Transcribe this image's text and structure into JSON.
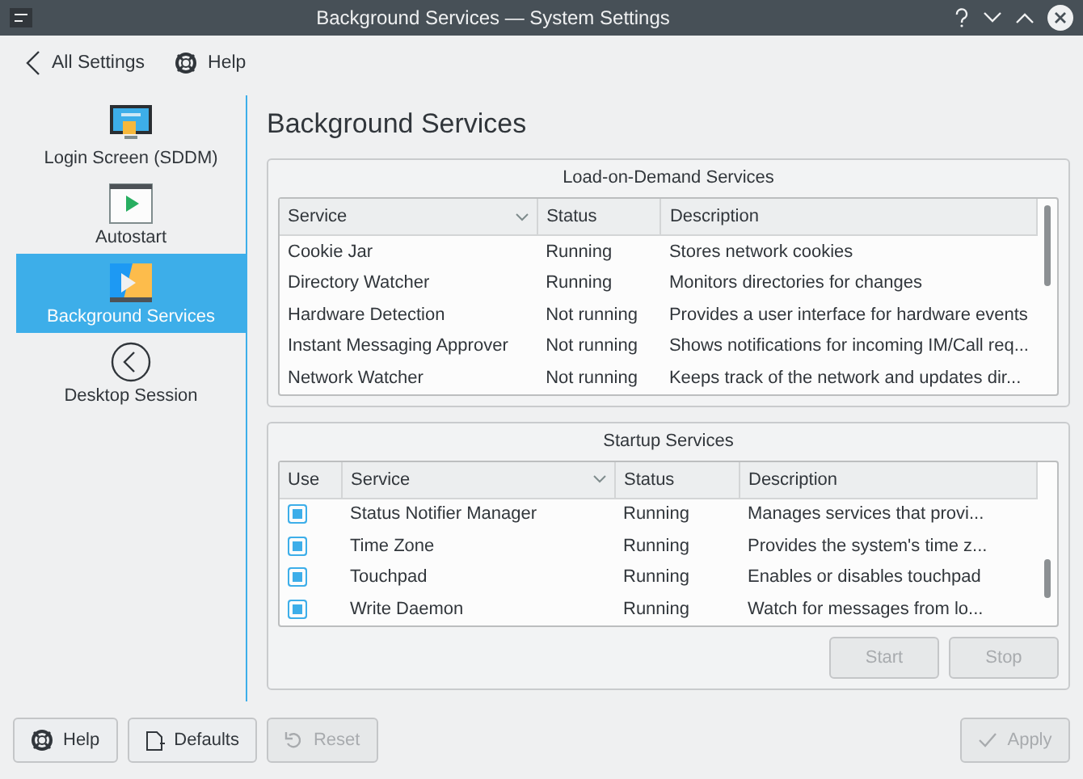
{
  "window": {
    "title": "Background Services — System Settings"
  },
  "toolbar": [
    {
      "label": "All Settings",
      "kind": "back"
    },
    {
      "label": "Help",
      "kind": "help"
    }
  ],
  "sidebar": {
    "items": [
      {
        "label": "Login Screen (SDDM)",
        "kind": "monitor",
        "selected": false
      },
      {
        "label": "Autostart",
        "kind": "play",
        "selected": false
      },
      {
        "label": "Background Services",
        "kind": "services",
        "selected": true
      },
      {
        "label": "Desktop Session",
        "kind": "session",
        "selected": false
      }
    ]
  },
  "page": {
    "title": "Background Services"
  },
  "load_on_demand": {
    "title": "Load-on-Demand Services",
    "columns": [
      {
        "label": "Service",
        "sorted": true
      },
      {
        "label": "Status",
        "sorted": false
      },
      {
        "label": "Description",
        "sorted": false
      }
    ],
    "rows": [
      {
        "service": "Cookie Jar",
        "status": "Running",
        "description": "Stores network cookies"
      },
      {
        "service": "Directory Watcher",
        "status": "Running",
        "description": "Monitors directories for changes"
      },
      {
        "service": "Hardware Detection",
        "status": "Not running",
        "description": "Provides a user interface for hardware events"
      },
      {
        "service": "Instant Messaging Approver",
        "status": "Not running",
        "description": "Shows notifications for incoming IM/Call req..."
      },
      {
        "service": "Network Watcher",
        "status": "Not running",
        "description": "Keeps track of the network and updates dir..."
      }
    ]
  },
  "startup": {
    "title": "Startup Services",
    "columns": [
      {
        "label": "Use",
        "sorted": false
      },
      {
        "label": "Service",
        "sorted": true
      },
      {
        "label": "Status",
        "sorted": false
      },
      {
        "label": "Description",
        "sorted": false
      }
    ],
    "rows": [
      {
        "use": true,
        "service": "Status Notifier Manager",
        "status": "Running",
        "description": "Manages services that provi..."
      },
      {
        "use": true,
        "service": "Time Zone",
        "status": "Running",
        "description": "Provides the system's time z..."
      },
      {
        "use": true,
        "service": "Touchpad",
        "status": "Running",
        "description": "Enables or disables touchpad"
      },
      {
        "use": true,
        "service": "Write Daemon",
        "status": "Running",
        "description": "Watch for messages from lo..."
      }
    ],
    "buttons": [
      {
        "label": "Start",
        "disabled": true
      },
      {
        "label": "Stop",
        "disabled": true
      }
    ]
  },
  "footer": {
    "buttons": [
      {
        "label": "Help",
        "kind": "help",
        "disabled": false
      },
      {
        "label": "Defaults",
        "kind": "defaults",
        "disabled": false
      },
      {
        "label": "Reset",
        "kind": "reset",
        "disabled": true
      },
      {
        "label": "Apply",
        "kind": "apply",
        "disabled": true
      }
    ]
  }
}
